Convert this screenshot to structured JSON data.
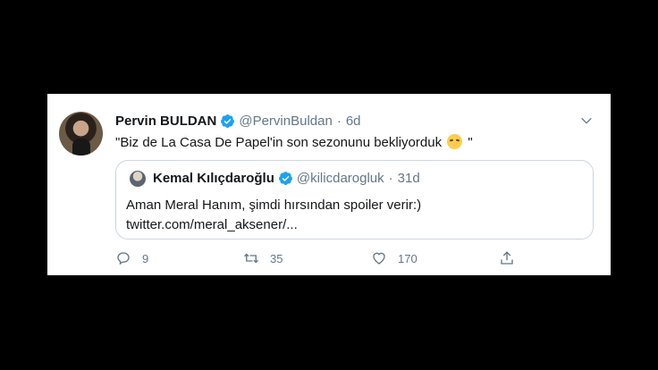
{
  "tweet": {
    "name": "Pervin BULDAN",
    "handle": "@PervinBuldan",
    "separator": "·",
    "time": "6d",
    "text_before_emoji": "\"Biz de La Casa De Papel'in son sezonunu bekliyorduk ",
    "text_after_emoji": " \""
  },
  "quoted": {
    "name": "Kemal Kılıçdaroğlu",
    "handle": "@kilicdarogluk",
    "separator": "·",
    "time": "31d",
    "line1": "Aman Meral Hanım, şimdi hırsından spoiler verir:)",
    "line2": "twitter.com/meral_aksener/..."
  },
  "actions": {
    "replies": "9",
    "retweets": "35",
    "likes": "170"
  },
  "colors": {
    "verified": "#1da1f2",
    "icon_gray": "#657786"
  }
}
